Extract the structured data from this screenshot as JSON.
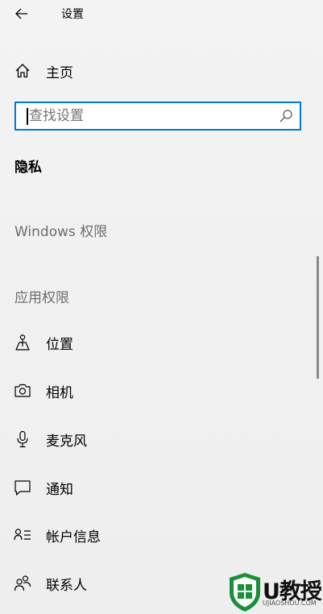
{
  "window": {
    "title": "设置"
  },
  "home": {
    "label": "主页",
    "icon": "home-icon"
  },
  "search": {
    "placeholder": "查找设置",
    "value": "",
    "icon": "search-icon"
  },
  "section": {
    "title": "隐私"
  },
  "groups": {
    "windows_permissions": "Windows 权限",
    "app_permissions": "应用权限"
  },
  "nav_items": [
    {
      "label": "位置",
      "icon": "location-icon"
    },
    {
      "label": "相机",
      "icon": "camera-icon"
    },
    {
      "label": "麦克风",
      "icon": "microphone-icon"
    },
    {
      "label": "通知",
      "icon": "notification-icon"
    },
    {
      "label": "帐户信息",
      "icon": "account-info-icon"
    },
    {
      "label": "联系人",
      "icon": "contacts-icon"
    }
  ],
  "watermark": {
    "text": "U教授",
    "subtext": "UJIAOSHOU.COM"
  },
  "colors": {
    "accent": "#0078d7",
    "background": "#f0f0f0",
    "group_heading": "#6d6d6d",
    "watermark_green": "#1a8f3a"
  }
}
